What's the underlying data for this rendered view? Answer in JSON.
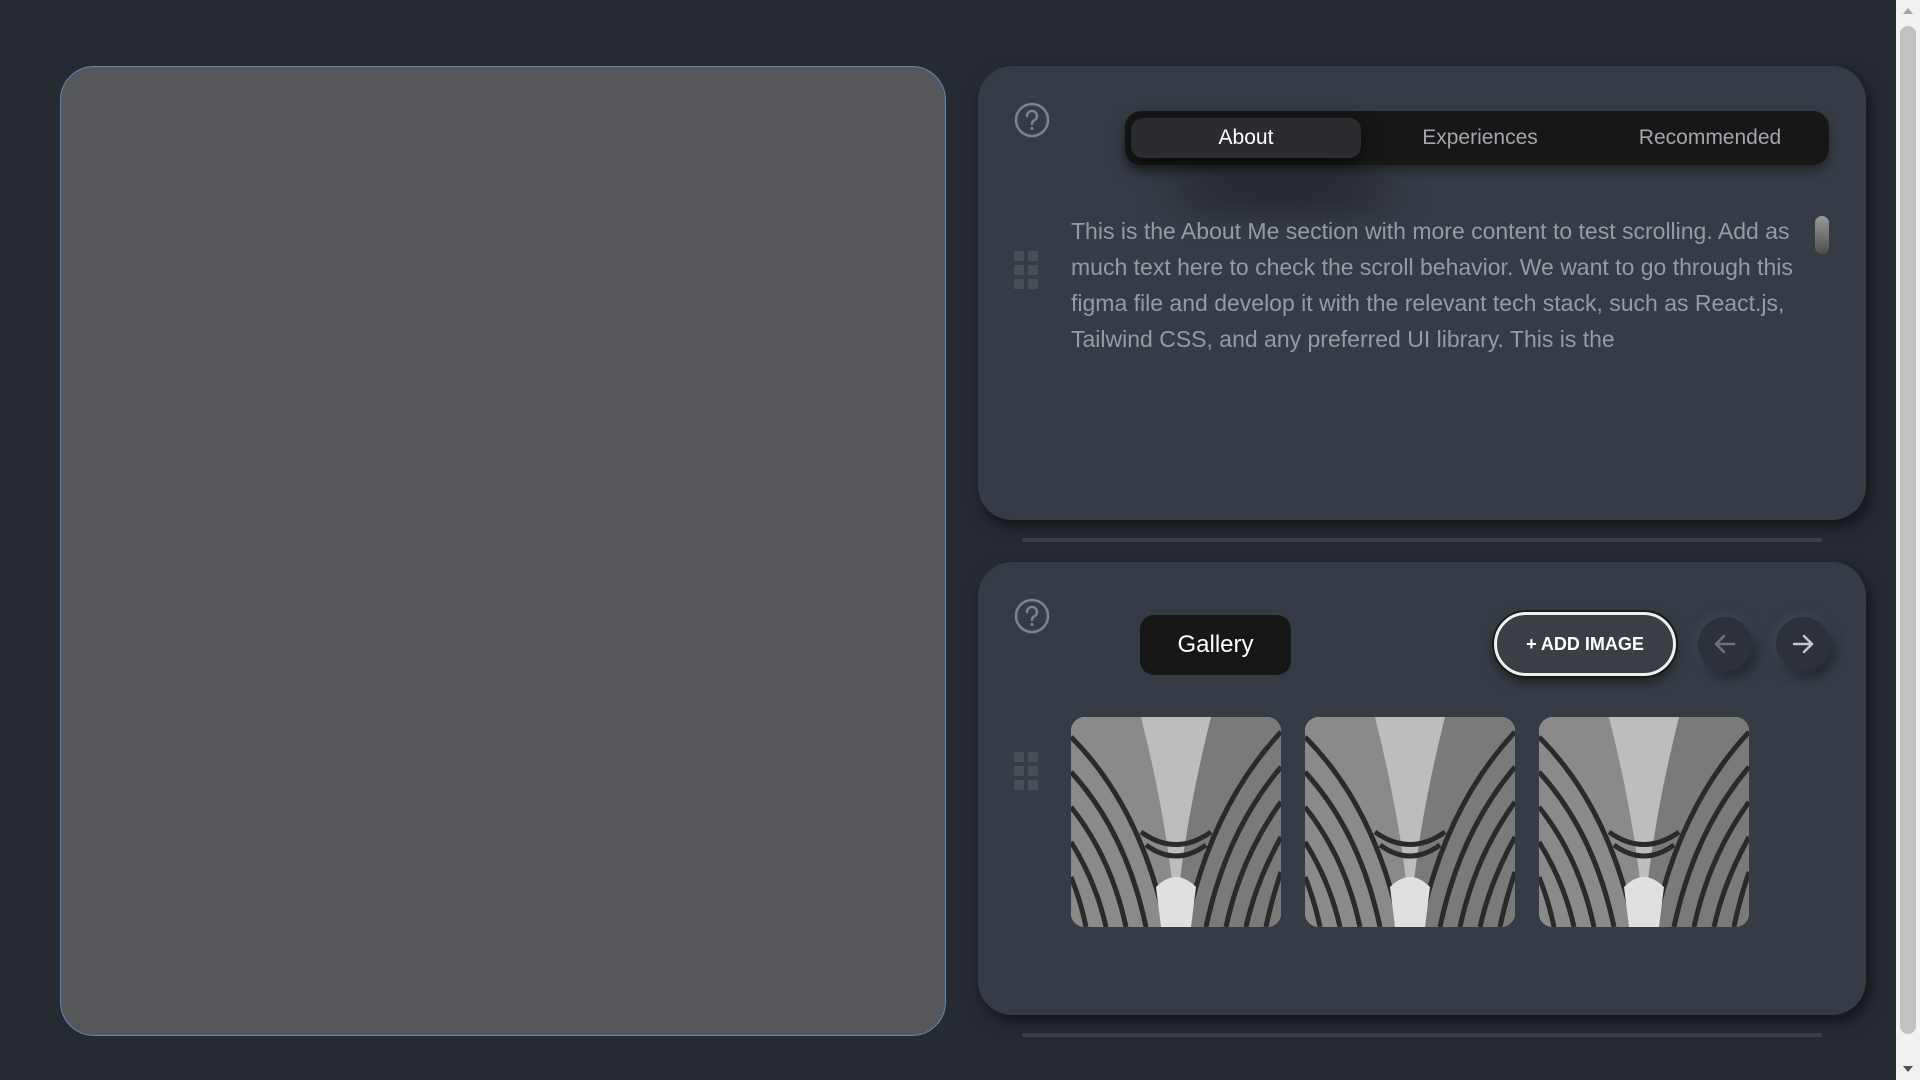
{
  "about_widget": {
    "tabs": [
      {
        "label": "About",
        "active": true
      },
      {
        "label": "Experiences",
        "active": false
      },
      {
        "label": "Recommended",
        "active": false
      }
    ],
    "text": "This is the About Me section with more content to test scrolling. Add as much text here to check the scroll behavior. We want to go through this figma file and develop it with the relevant tech stack, such as React.js, Tailwind CSS, and any preferred UI library. This is the",
    "icons": [
      "help-icon",
      "drag-handle-icon"
    ]
  },
  "gallery_widget": {
    "title": "Gallery",
    "add_button_label": "+ ADD IMAGE",
    "nav": [
      "arrow-left-icon",
      "arrow-right-icon"
    ],
    "images": [
      {
        "name": "architecture-photo"
      },
      {
        "name": "architecture-photo"
      },
      {
        "name": "architecture-photo"
      }
    ],
    "icons": [
      "help-icon",
      "drag-handle-icon"
    ]
  },
  "colors": {
    "background": "#262b32",
    "panel": "#363c45",
    "left_panel": "#55575a",
    "left_panel_border": "#5b87c4",
    "tab_bar": "#171717",
    "active_tab": "#2a2c30"
  }
}
